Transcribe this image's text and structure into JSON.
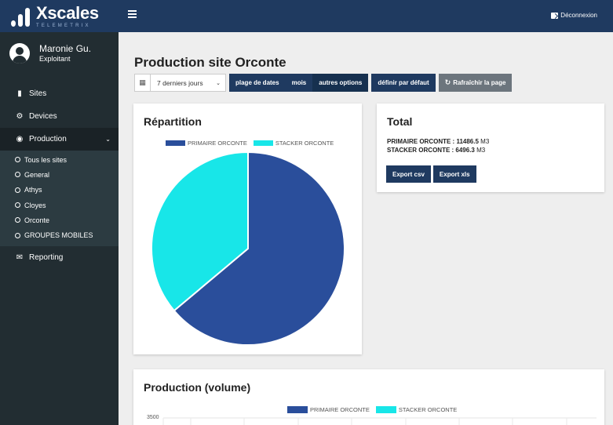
{
  "brand": {
    "name": "Xscales",
    "sub": "TELEMETRIX"
  },
  "user": {
    "name": "Maronie Gu.",
    "role": "Exploitant"
  },
  "nav": {
    "sites": "Sites",
    "devices": "Devices",
    "production": "Production",
    "reporting": "Reporting",
    "production_sub": [
      "Tous les sites",
      "General",
      "Athys",
      "Cloyes",
      "Orconte",
      "GROUPES MOBILES"
    ]
  },
  "topbar": {
    "logout": "Déconnexion"
  },
  "page": {
    "title": "Production site Orconte"
  },
  "toolbar": {
    "daterange_value": "7 derniers jours",
    "btn_plage": "plage de dates",
    "btn_mois": "mois",
    "btn_autres": "autres options",
    "btn_defaut": "définir par défaut",
    "btn_refresh": "Rafraîchir la page"
  },
  "repartition": {
    "title": "Répartition",
    "legend": [
      "PRIMAIRE ORCONTE",
      "STACKER ORCONTE"
    ]
  },
  "total": {
    "title": "Total",
    "line1_label": "PRIMAIRE ORCONTE : 11486.5",
    "line2_label": "STACKER ORCONTE : 6496.3",
    "unit": "M3",
    "export_csv": "Export csv",
    "export_xls": "Export xls"
  },
  "volume": {
    "title": "Production (volume)",
    "legend": [
      "PRIMAIRE ORCONTE",
      "STACKER ORCONTE"
    ],
    "ytick_top": "3500"
  },
  "colors": {
    "primaire": "#2a4e9b",
    "stacker": "#18e6e8",
    "navy": "#1f3a60"
  },
  "chart_data": [
    {
      "type": "pie",
      "title": "Répartition",
      "categories": [
        "PRIMAIRE ORCONTE",
        "STACKER ORCONTE"
      ],
      "values": [
        11486.5,
        6496.3
      ],
      "legend": "top"
    },
    {
      "type": "bar",
      "title": "Production (volume)",
      "series": [
        {
          "name": "PRIMAIRE ORCONTE"
        },
        {
          "name": "STACKER ORCONTE"
        }
      ],
      "yticks_visible": [
        "3500"
      ],
      "legend": "top"
    }
  ]
}
